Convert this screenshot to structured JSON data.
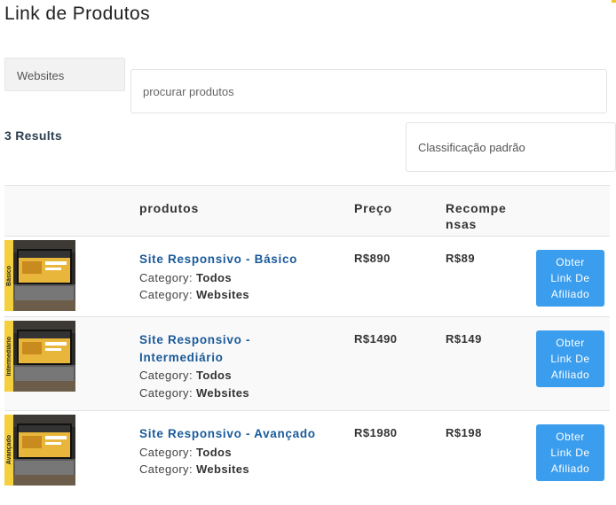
{
  "page": {
    "title": "Link de Produtos"
  },
  "filters": {
    "category_value": "Websites",
    "search_placeholder": "procurar produtos",
    "results_text": "3 Results",
    "sort_value": "Classificação padrão"
  },
  "table": {
    "headers": [
      "",
      "produtos",
      "Preço",
      "Recompe nsas",
      ""
    ],
    "rows": [
      {
        "tag": "Básico",
        "name": "Site Responsivo - Básico",
        "category_label": "Category:",
        "category": "Todos",
        "category2": "Websites",
        "price": "R$890",
        "reward": "R$89",
        "button": "Obter Link De Afiliado"
      },
      {
        "tag": "Intermediário",
        "name": "Site Responsivo - Intermediário",
        "category_label": "Category:",
        "category": "Todos",
        "category2": "Websites",
        "price": "R$1490",
        "reward": "R$149",
        "button": "Obter Link De Afiliado"
      },
      {
        "tag": "Avançado",
        "name": "Site Responsivo - Avançado",
        "category_label": "Category:",
        "category": "Todos",
        "category2": "Websites",
        "price": "R$1980",
        "reward": "R$198",
        "button": "Obter Link De Afiliado"
      }
    ]
  },
  "colors": {
    "accent": "#3b9ded",
    "link": "#1a5a9a",
    "tag": "#f4d03f"
  }
}
